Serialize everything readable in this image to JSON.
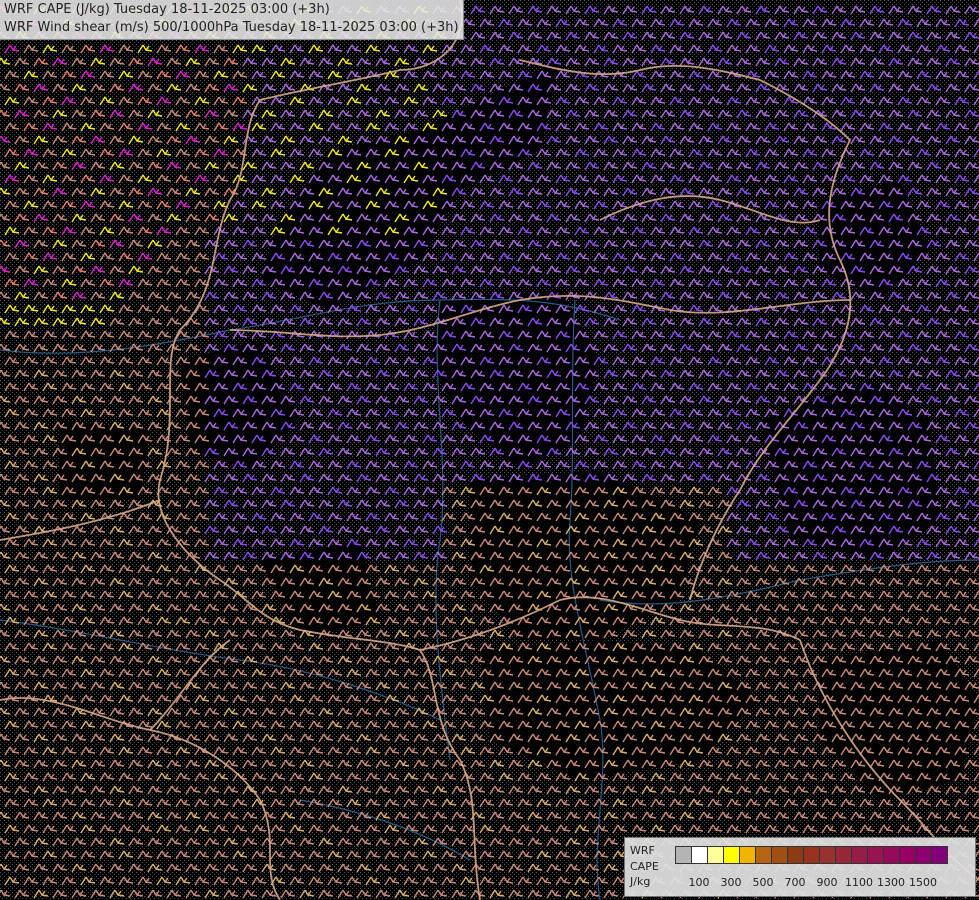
{
  "header": {
    "title_line1": "WRF CAPE (J/kg) Tuesday 18-11-2025 03:00 (+3h)",
    "title_line2": "WRF Wind shear (m/s) 500/1000hPa Tuesday 18-11-2025 03:00 (+3h)"
  },
  "legend": {
    "label_model": "WRF",
    "label_field": "CAPE",
    "label_unit": "J/kg",
    "swatch_colors": [
      "#b4b4b4",
      "#ffffff",
      "#ffff99",
      "#ffff00",
      "#f0b400",
      "#b46414",
      "#a05014",
      "#8c3c14",
      "#96321e",
      "#963232",
      "#96283c",
      "#961e46",
      "#961450",
      "#960a5a",
      "#960064",
      "#8c006e",
      "#820078"
    ],
    "tick_labels": [
      {
        "text": "100",
        "after_swatch": 1
      },
      {
        "text": "300",
        "after_swatch": 3
      },
      {
        "text": "500",
        "after_swatch": 5
      },
      {
        "text": "700",
        "after_swatch": 7
      },
      {
        "text": "900",
        "after_swatch": 9
      },
      {
        "text": "1100",
        "after_swatch": 11
      },
      {
        "text": "1300",
        "after_swatch": 13
      },
      {
        "text": "1500",
        "after_swatch": 15
      }
    ]
  },
  "colors": {
    "background": "#000000",
    "stipple": "#5a5a5a",
    "borders": "#d6a98a",
    "rivers": "#2e6fa8",
    "shear_low": "#c98b7a",
    "shear_mid": "#a96be0",
    "shear_strong": "#8a4df0",
    "shear_tan": "#d9b06a",
    "shear_salmon": "#e6806e",
    "shear_magenta": "#e020d0",
    "shear_yellow": "#f2ea20"
  }
}
